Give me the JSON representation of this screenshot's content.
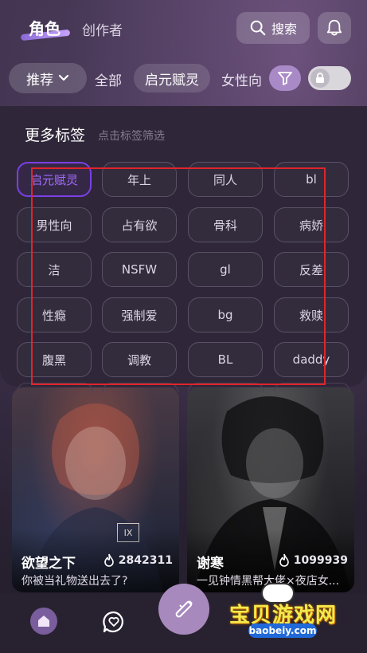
{
  "header": {
    "tabs": [
      "角色",
      "创作者"
    ],
    "search_label": "搜索",
    "icons": {
      "search": "search-icon",
      "notification": "bell-icon"
    }
  },
  "filter_row": {
    "dropdown_label": "推荐",
    "tabs": [
      "全部",
      "启元赋灵",
      "女性向"
    ],
    "selected_tab": "启元赋灵",
    "filter_icon": "filter-icon",
    "lock_toggle": {
      "icon": "lock-icon",
      "on": false
    }
  },
  "tag_panel": {
    "title": "更多标签",
    "hint": "点击标签筛选",
    "selected": "启元赋灵",
    "tags": [
      "启元赋灵",
      "年上",
      "同人",
      "bl",
      "男性向",
      "占有欲",
      "骨科",
      "病娇",
      "洁",
      "NSFW",
      "gl",
      "反差",
      "性瘾",
      "强制爱",
      "bg",
      "救赎",
      "腹黑",
      "调教",
      "BL",
      "daddy"
    ]
  },
  "cards": [
    {
      "name": "欲望之下",
      "heat": "2842311",
      "desc": "你被当礼物送出去了?",
      "badge": "IX"
    },
    {
      "name": "谢寒",
      "heat": "1099939",
      "desc": "一见钟情黑帮大佬×夜店女..."
    }
  ],
  "bottom_nav": {
    "items": [
      "home-icon",
      "chat-heart-icon",
      "create-wand-icon"
    ]
  },
  "watermark": {
    "text": "宝贝游戏网",
    "url": "baobeiy.com"
  },
  "colors": {
    "accent": "#7b3fe6",
    "filter_button": "#a98ac7",
    "panel_bg": "#2f2739",
    "highlight_box": "#e0242c"
  }
}
